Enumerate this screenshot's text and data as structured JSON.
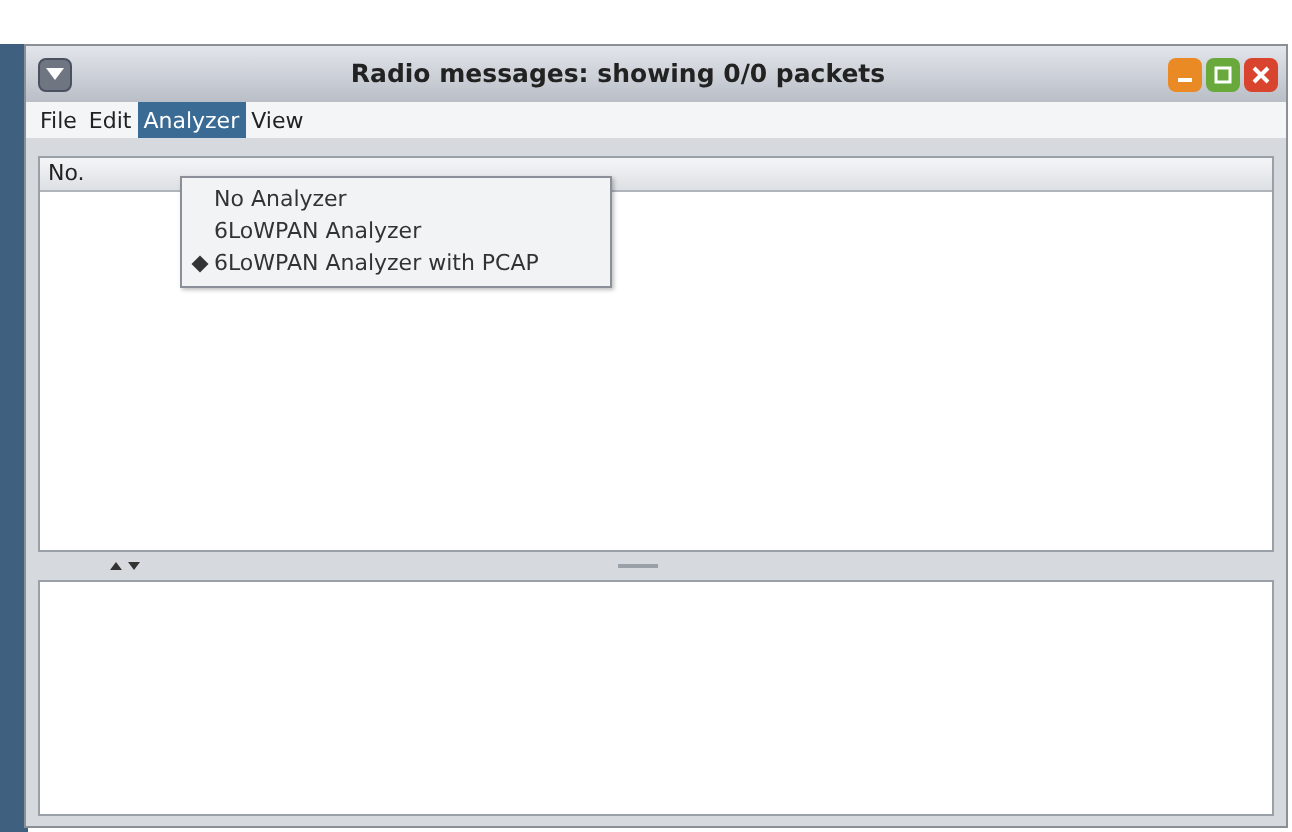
{
  "window": {
    "title": "Radio messages: showing 0/0 packets"
  },
  "menu_bar": [
    {
      "label": "File",
      "selected": false
    },
    {
      "label": "Edit",
      "selected": false
    },
    {
      "label": "Analyzer",
      "selected": true
    },
    {
      "label": "View",
      "selected": false
    }
  ],
  "dropdown": {
    "items": [
      {
        "label": "No Analyzer",
        "selected": false
      },
      {
        "label": "6LoWPAN Analyzer",
        "selected": false
      },
      {
        "label": "6LoWPAN Analyzer with PCAP",
        "selected": true
      }
    ]
  },
  "table": {
    "columns": [
      "No."
    ]
  }
}
